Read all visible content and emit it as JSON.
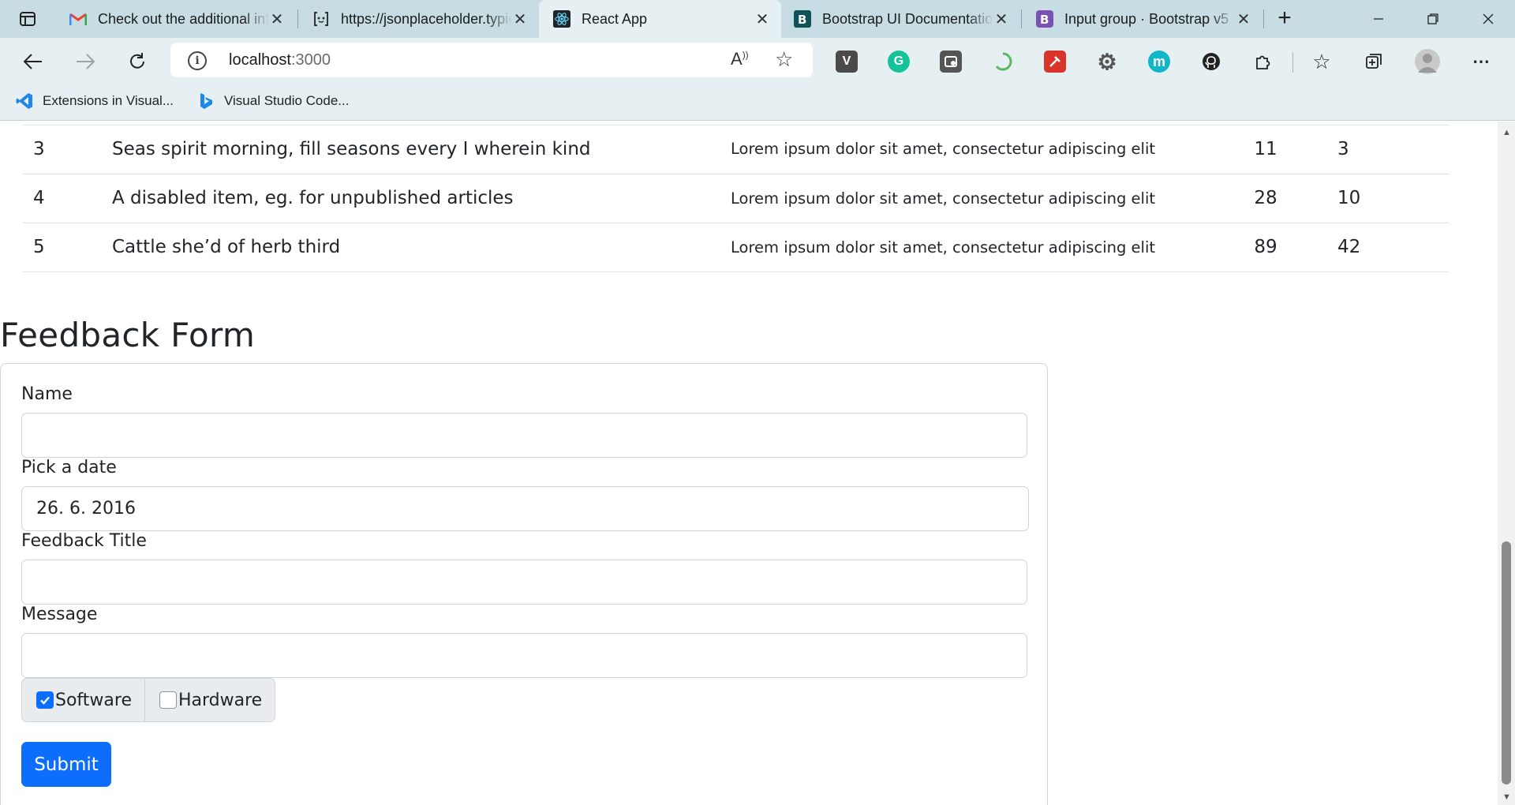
{
  "browser": {
    "tabs": [
      {
        "title": "Check out the additional info",
        "icon": "gmail-icon",
        "active": false
      },
      {
        "title": "https://jsonplaceholder.typicode.com",
        "icon": "jsonplaceholder-icon",
        "active": false
      },
      {
        "title": "React App",
        "icon": "react-icon",
        "active": true
      },
      {
        "title": "Bootstrap UI Documentation",
        "icon": "bootstrap-icon",
        "active": false
      },
      {
        "title": "Input group · Bootstrap v5",
        "icon": "bootstrap-purple-icon",
        "active": false
      }
    ],
    "address": {
      "host": "localhost",
      "port": ":3000"
    },
    "bookmarks": [
      {
        "label": "Extensions in Visual...",
        "icon": "vscode-icon"
      },
      {
        "label": "Visual Studio Code...",
        "icon": "bing-icon"
      }
    ],
    "extensions": [
      {
        "name": "v-extension-icon",
        "letter": "V",
        "color": "#4a4a4a"
      },
      {
        "name": "grammarly-icon",
        "letter": "G",
        "color": "#15c39a"
      },
      {
        "name": "screen-capture-extension-icon",
        "letter": "",
        "color": "#555555"
      },
      {
        "name": "loading-extension-icon",
        "letter": "",
        "color": "#5cb85c"
      },
      {
        "name": "colorzilla-icon",
        "letter": "",
        "color": "#d9342b"
      },
      {
        "name": "settings-extension-icon",
        "letter": "",
        "color": "#555555"
      },
      {
        "name": "m-extension-icon",
        "letter": "m",
        "color": "#12b6c9"
      },
      {
        "name": "github-icon",
        "letter": "",
        "color": "#222222"
      }
    ]
  },
  "table": {
    "rows": [
      {
        "id": "3",
        "title": "Seas spirit morning, fill seasons every I wherein kind",
        "body": "Lorem ipsum dolor sit amet, consectetur adipiscing elit",
        "a": "11",
        "b": "3"
      },
      {
        "id": "4",
        "title": "A disabled item, eg. for unpublished articles",
        "body": "Lorem ipsum dolor sit amet, consectetur adipiscing elit",
        "a": "28",
        "b": "10"
      },
      {
        "id": "5",
        "title": "Cattle she’d of herb third",
        "body": "Lorem ipsum dolor sit amet, consectetur adipiscing elit",
        "a": "89",
        "b": "42"
      }
    ]
  },
  "form": {
    "title": "Feedback Form",
    "name_label": "Name",
    "name_value": "",
    "date_label": "Pick a date",
    "date_value": "26. 6. 2016",
    "feedback_title_label": "Feedback Title",
    "feedback_title_value": "",
    "message_label": "Message",
    "message_value": "",
    "software_label": "Software",
    "software_checked": true,
    "hardware_label": "Hardware",
    "hardware_checked": false,
    "submit_label": "Submit",
    "accent_color": "#0d6efd"
  }
}
